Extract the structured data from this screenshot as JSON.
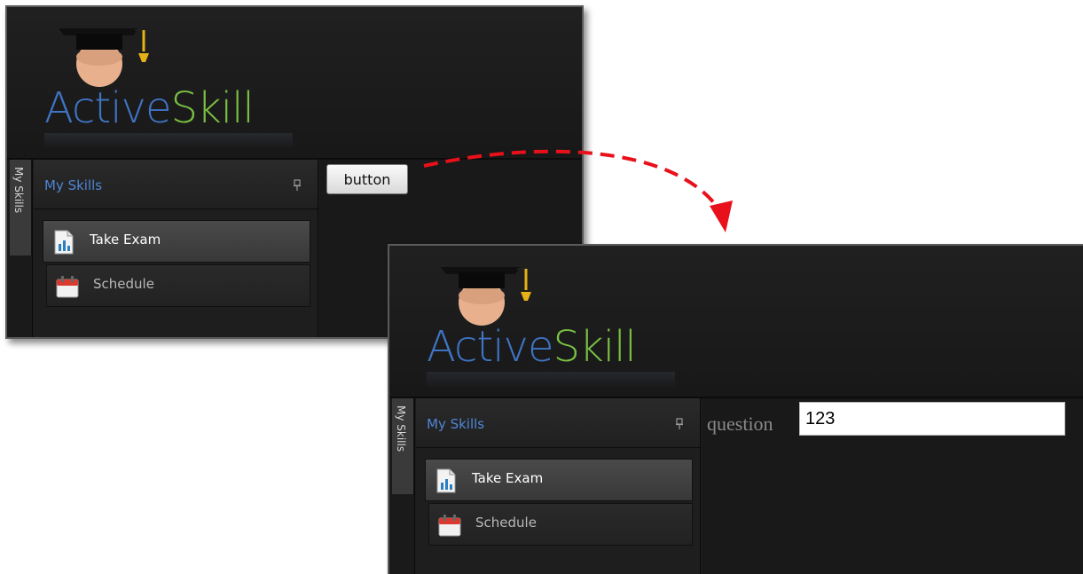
{
  "colors": {
    "brand_blue": "#3f74c4",
    "brand_green": "#7ac043",
    "panel_title": "#4f86d6",
    "arrow": "#e8101a"
  },
  "logo": {
    "part1": "Active",
    "part2": "Skill"
  },
  "side_tab_label": "My Skills",
  "panel": {
    "title": "My Skills",
    "pin_icon": "pin-icon",
    "items": [
      {
        "label": "Take Exam",
        "icon": "exam-report-icon",
        "active": true
      },
      {
        "label": "Schedule",
        "icon": "calendar-icon",
        "active": false
      }
    ]
  },
  "window1": {
    "button_label": "button"
  },
  "window2": {
    "question_label": "question",
    "question_value": "123"
  }
}
